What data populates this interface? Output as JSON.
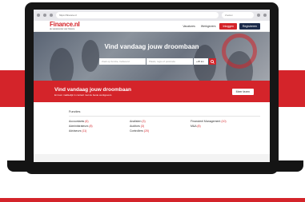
{
  "browser": {
    "url": "https://finance.nl",
    "search_placeholder": "Zoeken"
  },
  "site": {
    "logo": "Finance.nl",
    "tagline": "de vacaturesite voor finance",
    "nav": [
      "Vacatures",
      "Werkgevers"
    ],
    "login_label": "Inloggen",
    "register_label": "Registreren"
  },
  "hero": {
    "title": "Vind vandaag jouw droombaan",
    "search_placeholder": "Zoek op functie, trefwoord",
    "location_placeholder": "Plaats, regio of postcode",
    "radius_value": "+25 km"
  },
  "promo": {
    "title": "Vind vandaag jouw droombaan",
    "subtitle": "En kom makkelijk in contact met de beste werkgevers",
    "button_label": "Meer lezen"
  },
  "functions": {
    "title": "Functies",
    "items": [
      {
        "label": "Accountants",
        "count": "(6)"
      },
      {
        "label": "Analisten",
        "count": "(3)"
      },
      {
        "label": "Financieel Management",
        "count": "(10)"
      },
      {
        "label": "Administrateurs",
        "count": "(8)"
      },
      {
        "label": "Auditors",
        "count": "(3)"
      },
      {
        "label": "M&A",
        "count": "(8)"
      },
      {
        "label": "Adviseurs",
        "count": "(11)"
      },
      {
        "label": "Controllers",
        "count": "(20)"
      }
    ]
  },
  "colors": {
    "brand_red": "#d4242a",
    "navy": "#1c2b4a"
  }
}
